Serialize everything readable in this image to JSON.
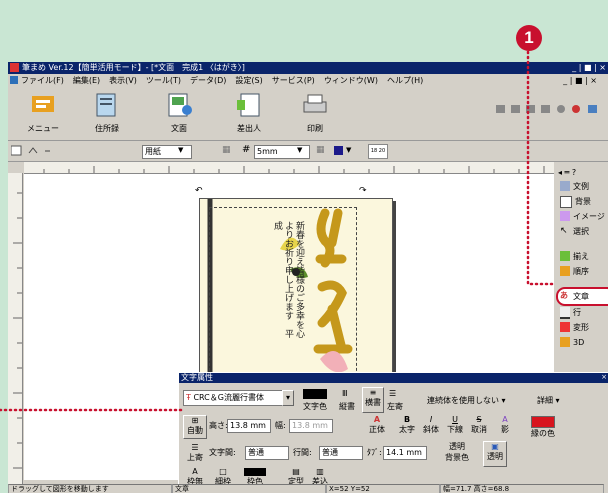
{
  "callout": {
    "number": "1"
  },
  "window": {
    "title": "筆まめ Ver.12【簡単活用モード】- [*文面　完成1 〈はがき〉]",
    "buttons": "_ | ■ | ×",
    "menu": [
      "ファイル(F)",
      "編集(E)",
      "表示(V)",
      "ツール(T)",
      "データ(D)",
      "設定(S)",
      "サービス(P)",
      "ウィンドウ(W)",
      "ヘルプ(H)"
    ]
  },
  "toolbar": {
    "buttons": [
      {
        "label": "メニュー",
        "icon": "menu-icon"
      },
      {
        "label": "住所録",
        "icon": "address-book-icon"
      },
      {
        "label": "文面",
        "icon": "design-icon"
      },
      {
        "label": "差出人",
        "icon": "sender-icon"
      },
      {
        "label": "印刷",
        "icon": "printer-icon"
      }
    ]
  },
  "format_bar": {
    "paper_select": "用紙",
    "grid_select": "5mm",
    "small_value": "18 20"
  },
  "side_panel": {
    "items": [
      "文例",
      "背景",
      "イメージ",
      "選択",
      "揃え",
      "順序",
      "文章",
      "行",
      "変形",
      "3D"
    ]
  },
  "card": {
    "vertical_text": "新春を迎え皆様のご多幸を心よりお祈り申し上げます　平成"
  },
  "dialog": {
    "title": "文字属性",
    "font": "CRC＆G流麗行書体",
    "text_color_label": "文字色",
    "vertical_label": "縦書",
    "horizontal_label": "横書",
    "align_left_label": "左寄",
    "connected_label": "連続体を使用しない",
    "detail_label": "詳細",
    "auto_label": "自動",
    "height_label": "高さ:",
    "height_value": "13.8 mm",
    "width_label": "幅:",
    "width_value": "13.8 mm",
    "normal_label": "正体",
    "bold_label": "太字",
    "italic_label": "斜体",
    "underline_label": "下線",
    "cancel_label": "取消",
    "shadow_label": "影",
    "border_color_label": "縁の色",
    "top_align_label": "上寄",
    "char_spacing_label": "文字間:",
    "char_spacing_value": "普通",
    "line_spacing_label": "行間:",
    "line_spacing_value": "普通",
    "tab_label": "ﾀﾌﾞ:",
    "tab_value": "14.1 mm",
    "transparent_label": "透明",
    "bg_color_label": "背景色",
    "transparent2_label": "透明",
    "no_frame_label": "枠無",
    "thin_frame_label": "細枠",
    "frame_color_label": "枠色",
    "fixed_label": "定型",
    "insert_label": "差込"
  },
  "status": {
    "hint": "ドラッグして図形を移動します",
    "mode": "文章",
    "coords": "X=52 Y=52",
    "size": "幅=71.7 高さ=68.8"
  },
  "colors": {
    "title_blue": "#0a246a",
    "callout": "#c8102e",
    "dot": "#c8102e"
  }
}
